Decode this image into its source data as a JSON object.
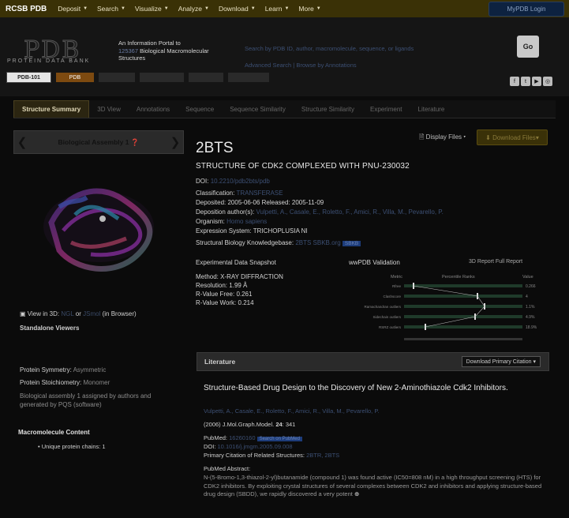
{
  "nav": {
    "brand": "RCSB PDB",
    "items": [
      "Deposit",
      "Search",
      "Visualize",
      "Analyze",
      "Download",
      "Learn",
      "More"
    ],
    "mypdb": "MyPDB Login"
  },
  "header": {
    "logo_text": "PDB",
    "logo_subtitle": "PROTEIN DATA BANK",
    "tagline_1": "An Information Portal to",
    "tagline_count": "125367",
    "tagline_2": "Biological Macromolecular Structures",
    "search_placeholder": "Search by PDB ID, author, macromolecule, sequence, or ligands",
    "search_links": "Advanced Search | Browse by Annotations",
    "go": "Go",
    "pdb101": "PDB-101",
    "pdbtile": "PDB"
  },
  "tabs": [
    "Structure Summary",
    "3D View",
    "Annotations",
    "Sequence",
    "Sequence Similarity",
    "Structure Similarity",
    "Experiment",
    "Literature"
  ],
  "left": {
    "assembly_label": "Biological Assembly 1",
    "view3d_prefix": "View in 3D:",
    "view3d_mid": "or",
    "view3d_suffix": "(in Browser)",
    "standalone_title": "Standalone Viewers",
    "protein_symmetry_label": "Protein Symmetry:",
    "protein_symmetry_value": "Asymmetric",
    "protein_stoich_label": "Protein Stoichiometry:",
    "protein_stoich_value": "Monomer",
    "bio_assembly_note": "Biological assembly 1 assigned by authors and generated by PQS (software)",
    "macro_title": "Macromolecule Content",
    "macro_item": "Unique protein chains: 1"
  },
  "entry": {
    "id": "2BTS",
    "title": "STRUCTURE OF CDK2 COMPLEXED WITH PNU-230032",
    "display_files": "Display Files",
    "download_files": "Download Files",
    "doi_label": "DOI:",
    "doi_value": "10.2210/pdb2bts/pdb",
    "classification_label": "Classification:",
    "classification_value": "TRANSFERASE",
    "deposited_label": "Deposited:",
    "deposited_value": "2005-06-06",
    "released_label": "Released:",
    "released_value": "2005-11-09",
    "authors_label": "Deposition author(s):",
    "authors_value": "Vulpetti, A., Casale, E., Roletto, F., Amici, R., Villa, M., Pevarello, P.",
    "organism_label": "Organism:",
    "organism_value": "Homo sapiens",
    "expression_label": "Expression System:",
    "expression_value": "TRICHOPLUSIA NI",
    "sbkb_label": "Structural Biology Knowledgebase:",
    "sbkb_value": "2BTS SBKB.org",
    "sbkb_badge": "SBKB"
  },
  "experiment": {
    "title": "Experimental Data Snapshot",
    "method_label": "Method:",
    "method_value": "X-RAY DIFFRACTION",
    "resolution_label": "Resolution:",
    "resolution_value": "1.99 Å",
    "rfree_label": "R-Value Free:",
    "rfree_value": "0.261",
    "rwork_label": "R-Value Work:",
    "rwork_value": "0.214"
  },
  "validation": {
    "title": "wwPDB Validation",
    "links": "3D Report  Full Report",
    "col_metric": "Metric",
    "col_percentile": "Percentile Ranks",
    "col_value": "Value",
    "metrics": [
      "Rfree",
      "Clashscore",
      "Ramachandran outliers",
      "Sidechain outliers",
      "RSRZ outliers"
    ],
    "values": [
      "0.266",
      "4",
      "1.1%",
      "4.9%",
      "18.9%"
    ],
    "percentiles": [
      0.08,
      0.62,
      0.68,
      0.6,
      0.18
    ]
  },
  "literature": {
    "section_title": "Literature",
    "download_btn": "Download Primary Citation",
    "paper_title": "Structure-Based Drug Design to the Discovery of New 2-Aminothiazole Cdk2 Inhibitors.",
    "paper_authors": "Vulpetti, A., Casale, E., Roletto, F., Amici, R., Villa, M., Pevarello, P.",
    "ref_prefix": "(2006) J.Mol.Graph.Model.",
    "ref_volume": "24",
    "ref_page": ": 341",
    "pubmed_label": "PubMed:",
    "pubmed_value": "16260160",
    "pubmed_badge": "Search on PubMed",
    "doi_label": "DOI:",
    "doi_value": "10.1016/j.jmgm.2005.09.008",
    "citation_label": "Primary Citation of Related Structures:",
    "citation_value": "2BTR, 2BTS",
    "abstract_title": "PubMed Abstract:",
    "abstract": "N-(5-Bromo-1,3-thiazol-2-yl)butanamide (compound 1) was found active (IC50=808 nM) in a high throughput screening (HTS) for CDK2 inhibitors. By exploiting crystal structures of several complexes between CDK2 and inhibitors and applying structure-based drug design (SBDD), we rapidly discovered a very potent"
  },
  "colors": {
    "nav_bg": "#3a3106",
    "accent": "#5a4c10",
    "link": "#3c4f73"
  }
}
